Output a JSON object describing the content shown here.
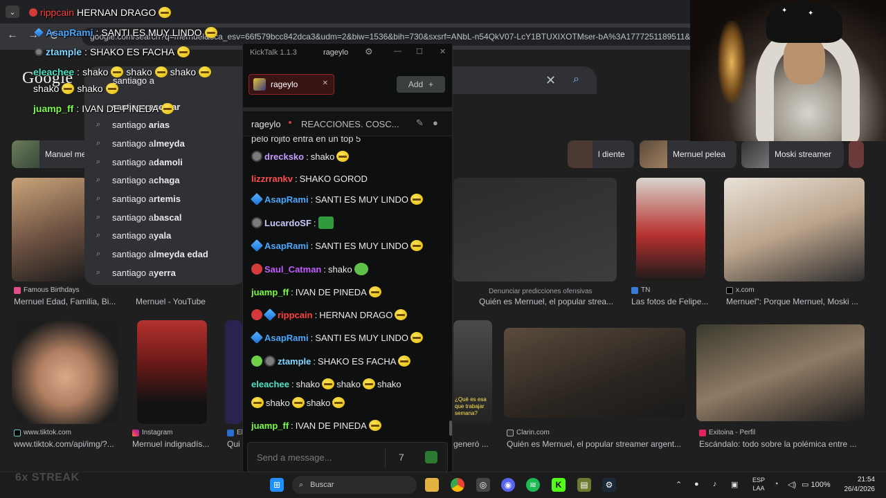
{
  "browser": {
    "url": "google.com/search?q=mernuel&sca_esv=66f579bcc842dca3&udm=2&biw=1536&bih=730&sxsrf=ANbL-n54QkV07-LcY1BTUXIXOTMser-bA%3A1777251189511&ei=c"
  },
  "google": {
    "logo": "Google",
    "search_text": "santiago a",
    "suggestions": [
      {
        "prefix": "santiago a",
        "bold": "scibar"
      },
      {
        "prefix": "santiago ",
        "bold": "arias"
      },
      {
        "prefix": "santiago a",
        "bold": "lmeyda"
      },
      {
        "prefix": "santiago a",
        "bold": "damoli"
      },
      {
        "prefix": "santiago a",
        "bold": "chaga"
      },
      {
        "prefix": "santiago a",
        "bold": "rtemis"
      },
      {
        "prefix": "santiago a",
        "bold": "bascal"
      },
      {
        "prefix": "santiago a",
        "bold": "yala"
      },
      {
        "prefix": "santiago a",
        "bold": "lmeyda edad"
      },
      {
        "prefix": "santiago a",
        "bold": "yerra"
      }
    ],
    "report_link": "Denunciar predicciones ofensivas",
    "chips": [
      "Manuel me",
      "l diente",
      "Mernuel pelea",
      "Moski streamer"
    ],
    "results_row1": [
      {
        "source": "Famous Birthdays",
        "caption": "Mernuel Edad, Familia, Bi..."
      },
      {
        "source": "",
        "caption": "Mernuel - YouTube"
      },
      {
        "source": "",
        "caption": "Quién es Mernuel, el popular strea..."
      },
      {
        "source": "TN",
        "caption": "Las fotos de Felipe..."
      },
      {
        "source": "x.com",
        "caption": "Mernuel\": Porque Mernuel, Moski ..."
      }
    ],
    "results_row2": [
      {
        "source": "www.tiktok.com",
        "caption": "www.tiktok.com/api/img/?..."
      },
      {
        "source": "Instagram",
        "caption": "Mernuel indignadís..."
      },
      {
        "source": "El",
        "caption": "Qui"
      },
      {
        "source": "",
        "caption": "generó ..."
      },
      {
        "source": "Clarin.com",
        "caption": "Quién es Mernuel, el popular streamer argent..."
      },
      {
        "source": "Exitoina - Perfil",
        "caption": "Escándalo: todo sobre la polémica entre ..."
      }
    ],
    "image_overlay_text": "¿Qué es esa que trabajar semana?"
  },
  "overlay": {
    "streak": "6x STREAK",
    "lines": [
      {
        "user": "rippcain",
        "text": "HERNAN DRAGO",
        "color": "#ff4040"
      },
      {
        "user": "AsapRami",
        "text": "SANTI ES MUY LINDO",
        "color": "#4aa8ff"
      },
      {
        "user": "ztample",
        "text": "SHAKO ES FACHA",
        "color": "#7fd7ff"
      },
      {
        "user": "eleachee",
        "text": "shako",
        "color": "#50e3c2"
      },
      {
        "user": "",
        "text": "shako",
        "color": "#ffffff"
      },
      {
        "user": "juamp_ff",
        "text": "IVAN DE PINEDA",
        "color": "#7cfc4a"
      }
    ]
  },
  "kicktalk": {
    "app_title": "KickTalk 1.1.3",
    "channel": "rageylo",
    "tab_label": "rageylo",
    "add_label": "Add",
    "stream_title": "REACCIONES. COSC...",
    "cut_line": "pelo rojito entra en un top 5",
    "messages": [
      {
        "user": "drecksko",
        "text": "shako",
        "color": "#c89cff"
      },
      {
        "user": "lizzrrankv",
        "text": "SHAKO GOROD",
        "color": "#ff4d4d"
      },
      {
        "user": "AsapRami",
        "text": "SANTI ES MUY LINDO",
        "color": "#4aa8ff"
      },
      {
        "user": "LucardoSF",
        "text": "",
        "color": "#c9c9ff"
      },
      {
        "user": "AsapRami",
        "text": "SANTI ES MUY LINDO",
        "color": "#4aa8ff"
      },
      {
        "user": "Saul_Catman",
        "text": "shako",
        "color": "#c45cff"
      },
      {
        "user": "juamp_ff",
        "text": "IVAN DE PINEDA",
        "color": "#7cfc4a"
      },
      {
        "user": "rippcain",
        "text": "HERNAN DRAGO",
        "color": "#ff4040"
      },
      {
        "user": "AsapRami",
        "text": "SANTI ES MUY LINDO",
        "color": "#4aa8ff"
      },
      {
        "user": "ztample",
        "text": "SHAKO ES FACHA",
        "color": "#7fd7ff"
      },
      {
        "user": "eleachee",
        "text": "shako",
        "color": "#50e3c2"
      },
      {
        "user": "juamp_ff",
        "text": "IVAN DE PINEDA",
        "color": "#7cfc4a"
      }
    ],
    "elea_extra": [
      "shako",
      "shako",
      "shako",
      "shako"
    ],
    "input_placeholder": "Send a message..."
  },
  "taskbar": {
    "search_label": "Buscar",
    "lang_top": "ESP",
    "lang_bottom": "LAA",
    "battery": "100%",
    "time": "21:54",
    "date": "26/4/2026"
  },
  "colors": {
    "accent_blue": "#8ab4f8",
    "kick_green": "#53fc18"
  }
}
